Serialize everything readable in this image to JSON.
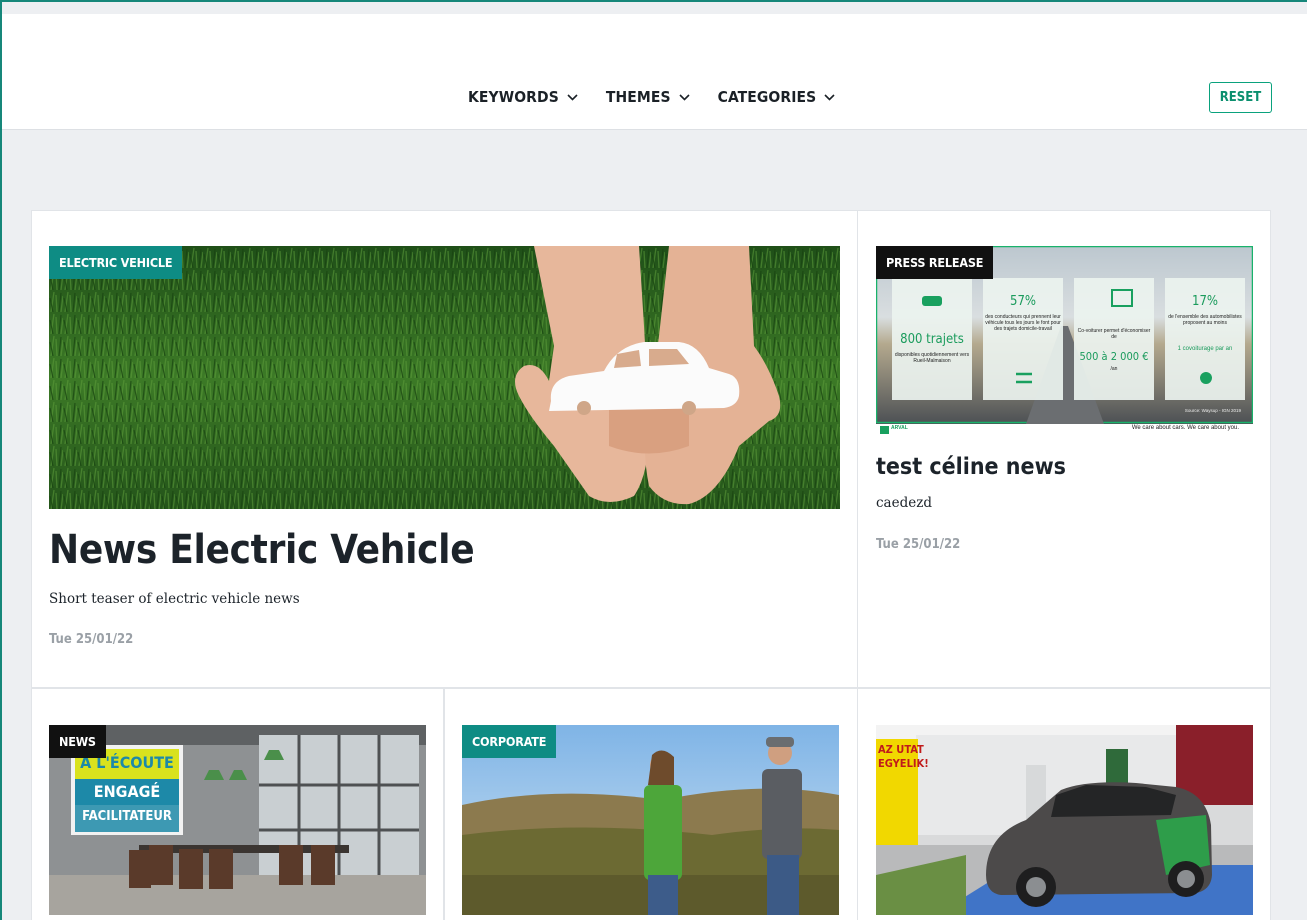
{
  "filters": {
    "keywords_label": "KEYWORDS",
    "themes_label": "THEMES",
    "categories_label": "CATEGORIES",
    "reset_label": "RESET"
  },
  "colors": {
    "accent": "#0aa27d",
    "tag_teal": "#0e8c84",
    "tag_black": "#111111",
    "page_bg": "#edeff2"
  },
  "cards": [
    {
      "tag": "ELECTRIC VEHICLE",
      "title": "News Electric Vehicle",
      "teaser": "Short teaser of electric vehicle news",
      "date": "Tue 25/01/22",
      "image": "hands-holding-paper-car-over-grass"
    },
    {
      "tag": "PRESS RELEASE",
      "title": "test céline news",
      "teaser": "caedezd",
      "date": "Tue 25/01/22",
      "image": "carpooling-infographic",
      "infographic": {
        "col1_big": "800 trajets",
        "col1_text": "disponibles quotidiennement vers Rueil-Malmaison",
        "col2_pct": "57%",
        "col2_text": "des conducteurs qui prennent leur véhicule tous les jours le font pour des trajets domicile-travail",
        "col3_text": "Co-voiturer permet d'économiser de",
        "col3_big": "500 à 2 000 €",
        "col3_sub": "/an",
        "col4_pct": "17%",
        "col4_text": "de l'ensemble des automobilistes proposent au moins",
        "col4_highlight": "1 covoiturage par an",
        "source": "Source: Waysup - IGN 2019",
        "brand": "ARVAL",
        "slogan": "We care about cars. We care about you."
      }
    },
    {
      "tag": "NEWS",
      "image": "meeting-room-with-billboard",
      "billboard": [
        "À L'ÉCOUTE",
        "ENGAGÉ",
        "FACILITATEUR"
      ]
    },
    {
      "tag": "CORPORATE",
      "image": "two-people-in-field"
    },
    {
      "tag": "",
      "image": "electric-car-at-charging-station",
      "sign": [
        "AZ UTAT",
        "EGYELIK!"
      ]
    }
  ]
}
